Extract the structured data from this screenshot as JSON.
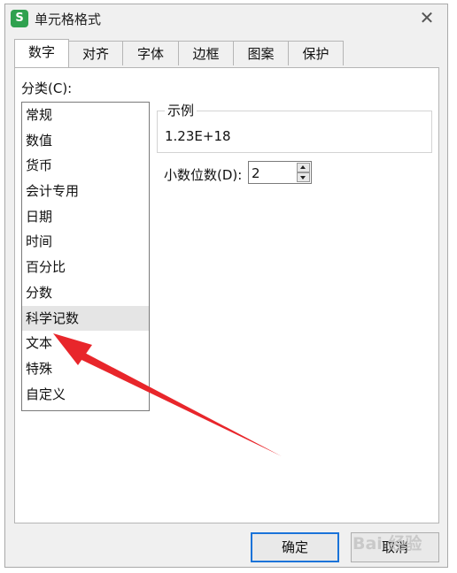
{
  "dialog": {
    "title": "单元格格式",
    "close_glyph": "✕",
    "app_icon_letter": "S"
  },
  "tabs": [
    {
      "label": "数字",
      "active": true
    },
    {
      "label": "对齐",
      "active": false
    },
    {
      "label": "字体",
      "active": false
    },
    {
      "label": "边框",
      "active": false
    },
    {
      "label": "图案",
      "active": false
    },
    {
      "label": "保护",
      "active": false
    }
  ],
  "category": {
    "label": "分类(C):",
    "items": [
      "常规",
      "数值",
      "货币",
      "会计专用",
      "日期",
      "时间",
      "百分比",
      "分数",
      "科学记数",
      "文本",
      "特殊",
      "自定义"
    ],
    "selected": "科学记数"
  },
  "sample": {
    "legend": "示例",
    "value": "1.23E+18"
  },
  "decimals": {
    "label": "小数位数(D):",
    "value": "2"
  },
  "buttons": {
    "ok": "确定",
    "cancel": "取消"
  },
  "annotation": {
    "arrow_color": "#e8262b",
    "points_to": "文本"
  },
  "watermark": {
    "text": "Bai 经验"
  },
  "colors": {
    "ok_border": "#1a73d9",
    "app_icon": "#2fa14f",
    "selected_row": "#e5e5e5"
  }
}
